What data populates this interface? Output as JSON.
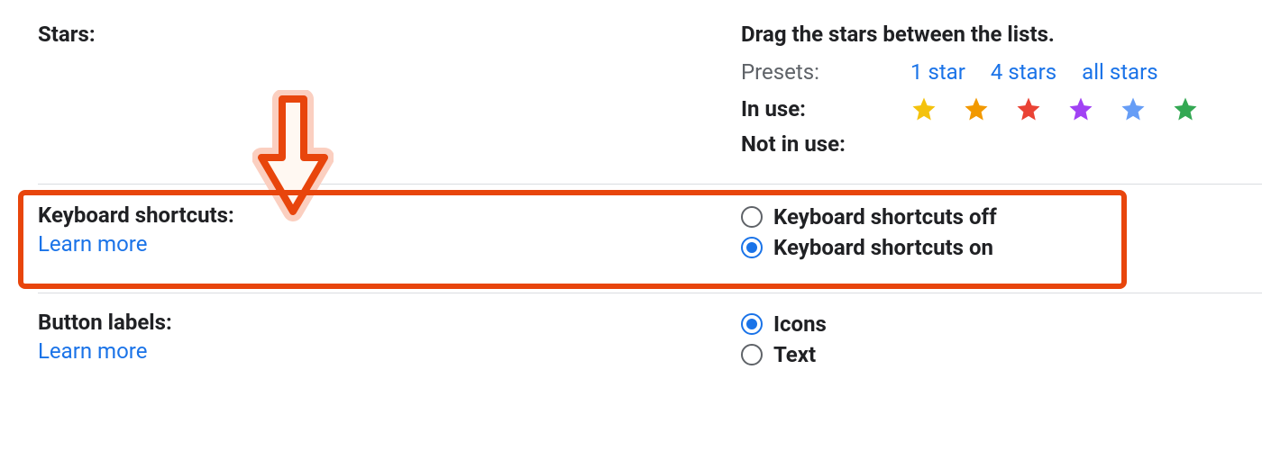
{
  "stars": {
    "label": "Stars:",
    "instruction": "Drag the stars between the lists.",
    "presets_label": "Presets:",
    "presets": [
      "1 star",
      "4 stars",
      "all stars"
    ],
    "in_use_label": "In use:",
    "in_use_stars": [
      {
        "name": "yellow-star",
        "color": "#f4c20d"
      },
      {
        "name": "orange-star",
        "color": "#f29900"
      },
      {
        "name": "red-star",
        "color": "#ea4335"
      },
      {
        "name": "purple-star",
        "color": "#a142f4"
      },
      {
        "name": "blue-star",
        "color": "#669df6"
      },
      {
        "name": "green-star",
        "color": "#34a853"
      }
    ],
    "not_in_use_label": "Not in use:"
  },
  "keyboard_shortcuts": {
    "label": "Keyboard shortcuts:",
    "learn_more": "Learn more",
    "options": [
      {
        "label": "Keyboard shortcuts off",
        "selected": false
      },
      {
        "label": "Keyboard shortcuts on",
        "selected": true
      }
    ]
  },
  "button_labels": {
    "label": "Button labels:",
    "learn_more": "Learn more",
    "options": [
      {
        "label": "Icons",
        "selected": true
      },
      {
        "label": "Text",
        "selected": false
      }
    ]
  },
  "annotation": {
    "arrow_color": "#e8450c",
    "arrow_halo": "#fbcfc0"
  }
}
